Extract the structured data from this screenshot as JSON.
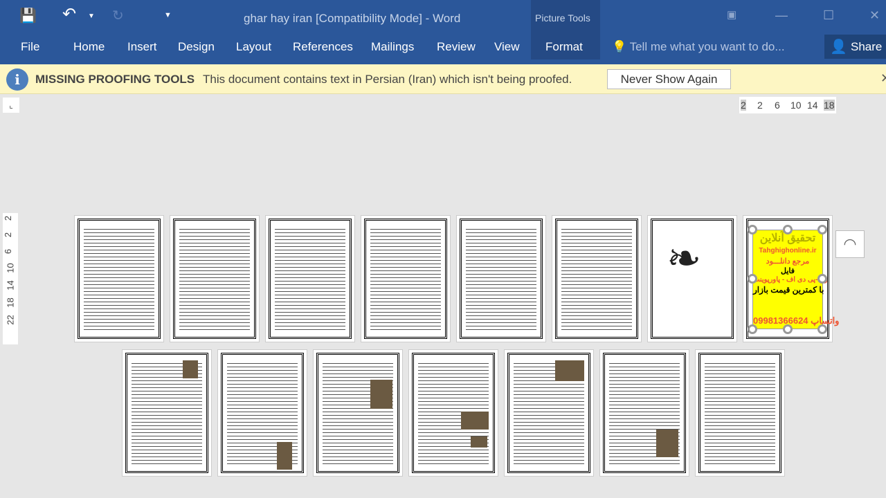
{
  "window": {
    "title": "ghar hay iran [Compatibility Mode] - Word",
    "context_tab": "Picture Tools"
  },
  "quick_access": {
    "save": "save-icon",
    "undo": "undo-icon",
    "redo": "redo-icon",
    "customize": "customize-icon"
  },
  "ribbon": {
    "tabs": [
      {
        "label": "File"
      },
      {
        "label": "Home"
      },
      {
        "label": "Insert"
      },
      {
        "label": "Design"
      },
      {
        "label": "Layout"
      },
      {
        "label": "References"
      },
      {
        "label": "Mailings"
      },
      {
        "label": "Review"
      },
      {
        "label": "View"
      },
      {
        "label": "Format"
      }
    ],
    "tell_me": "Tell me what you want to do...",
    "share": "Share"
  },
  "message_bar": {
    "title": "MISSING PROOFING TOOLS",
    "text": "This document contains text in Persian (Iran) which isn't being proofed.",
    "button": "Never Show Again"
  },
  "ruler": {
    "horizontal": [
      "2",
      "2",
      "6",
      "10",
      "14",
      "18"
    ],
    "vertical": [
      "2",
      "2",
      "6",
      "10",
      "14",
      "18",
      "22"
    ]
  },
  "ad": {
    "title": "تحقیق آنلاین",
    "site": "Tahghighonline.ir",
    "line1": "مرجع دانلـــود",
    "line2": "فایل",
    "line3": "ورد-پی دی اف - پاورپوینت",
    "line4": "با کمترین قیمت بازار",
    "phone": "09981366624 واتساپ"
  },
  "colors": {
    "ribbon": "#2b579a",
    "message_bar": "#fdf6c3",
    "accent": "#ffff00"
  }
}
